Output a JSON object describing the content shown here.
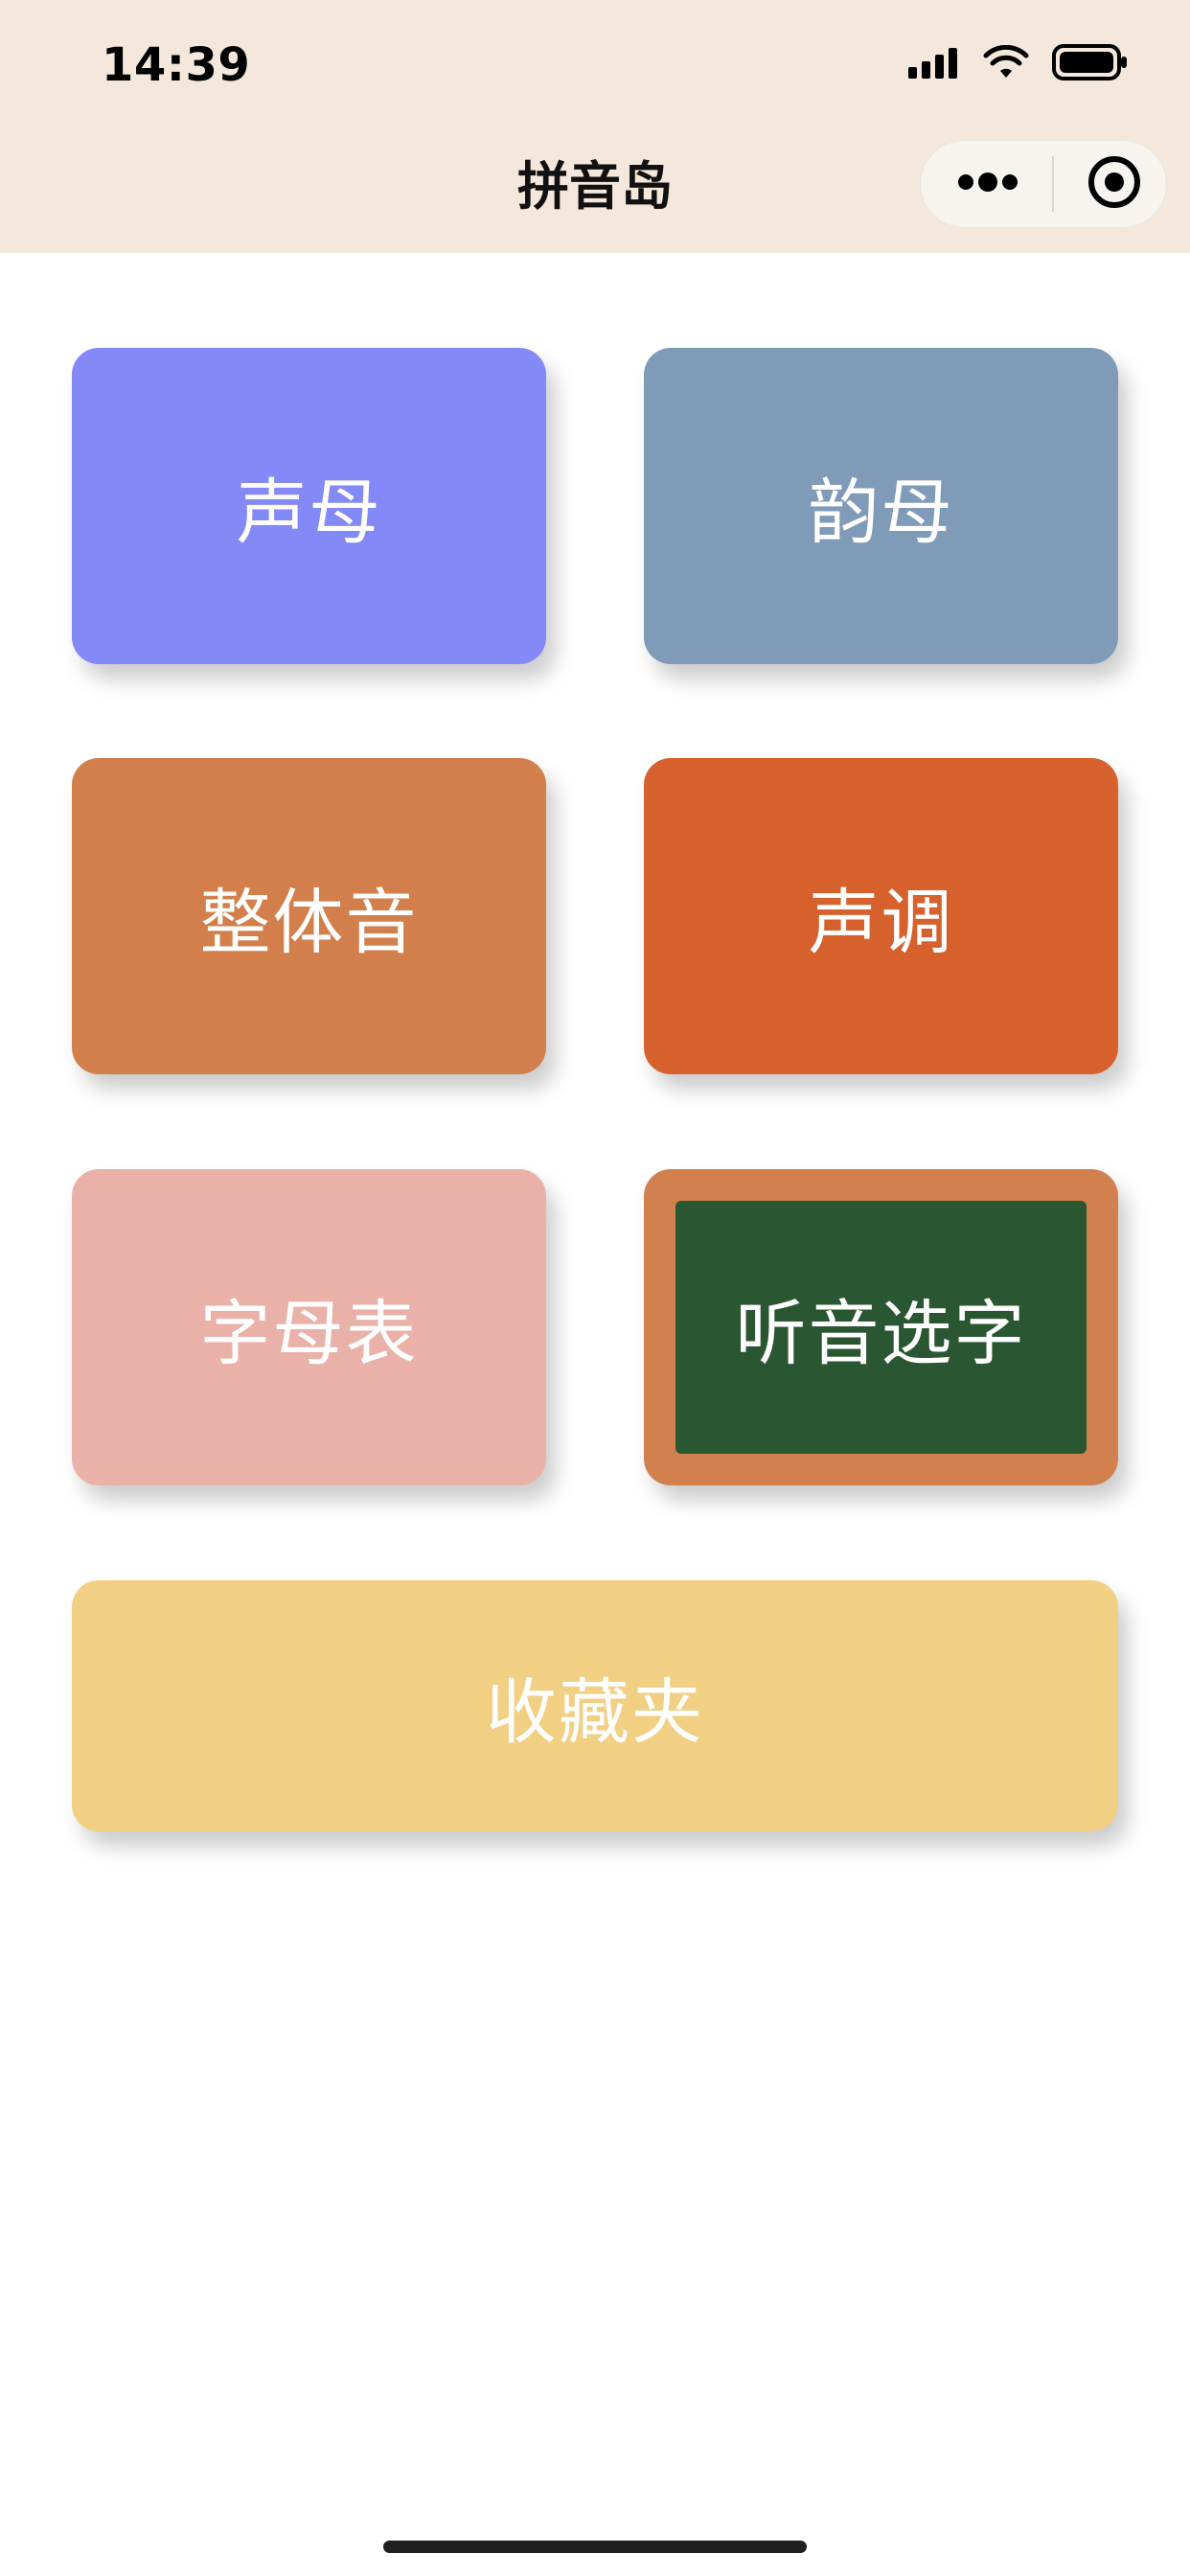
{
  "status_bar": {
    "time": "14:39"
  },
  "nav": {
    "title": "拼音岛"
  },
  "tiles": {
    "shengmu": {
      "label": "声母",
      "color": "#8389f6"
    },
    "yunmu": {
      "label": "韵母",
      "color": "#7f9bb8"
    },
    "zhengti": {
      "label": "整体音",
      "color": "#d27f4b"
    },
    "shengdiao": {
      "label": "声调",
      "color": "#d6612c"
    },
    "zimu": {
      "label": "字母表",
      "color": "#e9b1a8"
    },
    "tingyin": {
      "label": "听音选字",
      "frame_color": "#d2804e",
      "board_color": "#2a5631"
    },
    "shoucang": {
      "label": "收藏夹",
      "color": "#f1cf83"
    }
  },
  "colors": {
    "header_bg": "#f3e8db",
    "page_bg": "#ffffff"
  }
}
